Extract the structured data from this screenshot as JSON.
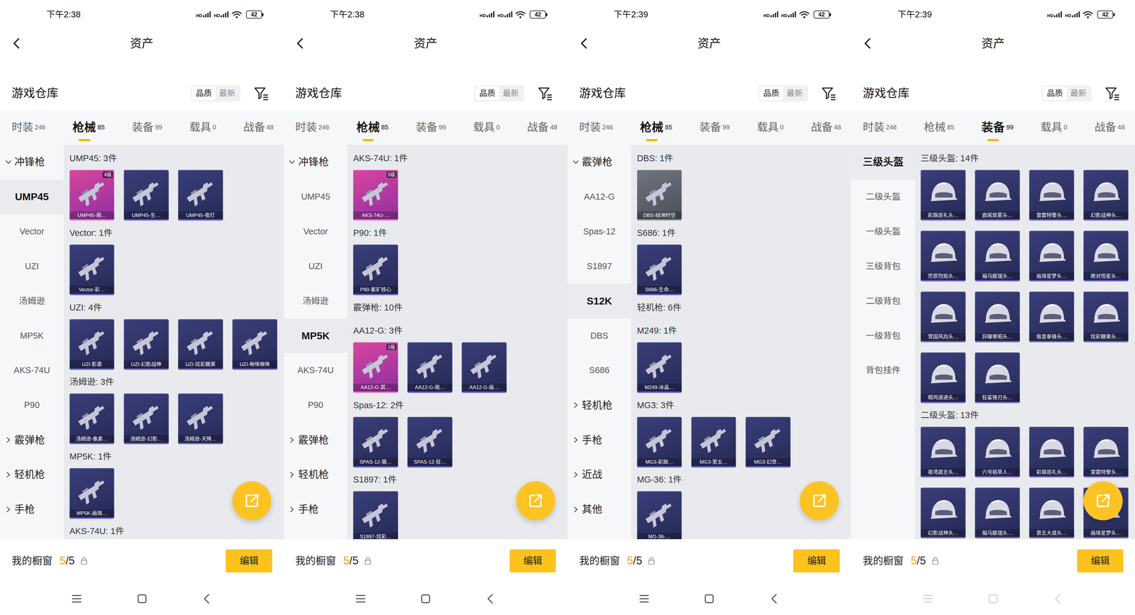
{
  "phones": [
    {
      "status": {
        "time": "下午2:38",
        "signal": [
          "HD",
          "HD"
        ],
        "battery": "42"
      },
      "title": "资产",
      "warehouse": {
        "title": "游戏仓库",
        "sort": [
          {
            "label": "品质",
            "selected": true
          },
          {
            "label": "最新",
            "selected": false
          }
        ]
      },
      "tabs": [
        {
          "label": "时装",
          "count": "246",
          "selected": false
        },
        {
          "label": "枪械",
          "count": "85",
          "selected": true
        },
        {
          "label": "装备",
          "count": "99",
          "selected": false
        },
        {
          "label": "载具",
          "count": "0",
          "selected": false
        },
        {
          "label": "战备",
          "count": "48",
          "selected": false
        }
      ],
      "sidebar": [
        {
          "label": "冲锋枪",
          "kind": "category",
          "expanded": true,
          "selected": false
        },
        {
          "label": "UMP45",
          "kind": "leaf",
          "selected": true
        },
        {
          "label": "Vector",
          "kind": "leaf",
          "selected": false
        },
        {
          "label": "UZI",
          "kind": "leaf",
          "selected": false
        },
        {
          "label": "汤姆逊",
          "kind": "leaf",
          "selected": false
        },
        {
          "label": "MP5K",
          "kind": "leaf",
          "selected": false
        },
        {
          "label": "AKS-74U",
          "kind": "leaf",
          "selected": false
        },
        {
          "label": "P90",
          "kind": "leaf",
          "selected": false
        },
        {
          "label": "霰弹枪",
          "kind": "category",
          "expanded": false,
          "selected": false
        },
        {
          "label": "轻机枪",
          "kind": "category",
          "expanded": false,
          "selected": false
        },
        {
          "label": "手枪",
          "kind": "category",
          "expanded": false,
          "selected": false
        }
      ],
      "sections": [
        {
          "title": "UMP45: 3件",
          "items": [
            {
              "label": "UMP45-萌…",
              "kind": "legendary",
              "badge": "4级"
            },
            {
              "label": "UMP45-生…",
              "kind": "epic"
            },
            {
              "label": "UMP45-夜灯",
              "kind": "epic"
            }
          ]
        },
        {
          "title": "Vector: 1件",
          "items": [
            {
              "label": "Vector-彩…",
              "kind": "epic"
            }
          ]
        },
        {
          "title": "UZI: 4件",
          "items": [
            {
              "label": "UZI-影袭",
              "kind": "epic"
            },
            {
              "label": "UZI-幻影战神",
              "kind": "epic"
            },
            {
              "label": "UZI-炫彩糖果",
              "kind": "epic"
            },
            {
              "label": "UZI-啾咪啾咪",
              "kind": "epic"
            }
          ]
        },
        {
          "title": "汤姆逊: 3件",
          "items": [
            {
              "label": "汤姆逊-像素…",
              "kind": "epic"
            },
            {
              "label": "汤姆逊-幻影…",
              "kind": "epic"
            },
            {
              "label": "汤姆逊-天降…",
              "kind": "epic"
            }
          ]
        },
        {
          "title": "MP5K: 1件",
          "items": [
            {
              "label": "MP5K-画境…",
              "kind": "epic"
            }
          ]
        },
        {
          "title": "AKS-74U: 1件",
          "items": []
        }
      ],
      "showcase": {
        "label": "我的橱窗",
        "used": "5",
        "total": "/5"
      },
      "edit_button": "编辑",
      "nav_faded": false
    },
    {
      "status": {
        "time": "下午2:38",
        "signal": [
          "HD",
          "HD"
        ],
        "battery": "42"
      },
      "title": "资产",
      "warehouse": {
        "title": "游戏仓库",
        "sort": [
          {
            "label": "品质",
            "selected": true
          },
          {
            "label": "最新",
            "selected": false
          }
        ]
      },
      "tabs": [
        {
          "label": "时装",
          "count": "246",
          "selected": false
        },
        {
          "label": "枪械",
          "count": "85",
          "selected": true
        },
        {
          "label": "装备",
          "count": "99",
          "selected": false
        },
        {
          "label": "载具",
          "count": "0",
          "selected": false
        },
        {
          "label": "战备",
          "count": "48",
          "selected": false
        }
      ],
      "sidebar": [
        {
          "label": "冲锋枪",
          "kind": "category",
          "expanded": true,
          "selected": false
        },
        {
          "label": "UMP45",
          "kind": "leaf",
          "selected": false
        },
        {
          "label": "Vector",
          "kind": "leaf",
          "selected": false
        },
        {
          "label": "UZI",
          "kind": "leaf",
          "selected": false
        },
        {
          "label": "汤姆逊",
          "kind": "leaf",
          "selected": false
        },
        {
          "label": "MP5K",
          "kind": "leaf",
          "selected": true
        },
        {
          "label": "AKS-74U",
          "kind": "leaf",
          "selected": false
        },
        {
          "label": "P90",
          "kind": "leaf",
          "selected": false
        },
        {
          "label": "霰弹枪",
          "kind": "category",
          "expanded": false,
          "selected": false
        },
        {
          "label": "轻机枪",
          "kind": "category",
          "expanded": false,
          "selected": false
        },
        {
          "label": "手枪",
          "kind": "category",
          "expanded": false,
          "selected": false
        }
      ],
      "sections": [
        {
          "title": "AKS-74U: 1件",
          "items": [
            {
              "label": "AKS-74U-…",
              "kind": "legendary",
              "badge": "5级"
            }
          ]
        },
        {
          "title": "P90: 1件",
          "items": [
            {
              "label": "P90-紫矿核心",
              "kind": "epic"
            }
          ]
        },
        {
          "title": "霰弹枪: 10件",
          "items": []
        },
        {
          "title": "AA12-G: 3件",
          "items": [
            {
              "label": "AA12-G-其…",
              "kind": "legendary",
              "badge": "1级"
            },
            {
              "label": "AA12-G-雨…",
              "kind": "epic"
            },
            {
              "label": "AA12-G-画…",
              "kind": "epic"
            }
          ]
        },
        {
          "title": "Spas-12: 2件",
          "items": [
            {
              "label": "SPAS-12-猫…",
              "kind": "epic"
            },
            {
              "label": "SPAS-12-狂…",
              "kind": "epic"
            }
          ]
        },
        {
          "title": "S1897: 1件",
          "items": [
            {
              "label": "S1897-炫彩…",
              "kind": "epic"
            }
          ]
        }
      ],
      "showcase": {
        "label": "我的橱窗",
        "used": "5",
        "total": "/5"
      },
      "edit_button": "编辑",
      "nav_faded": false
    },
    {
      "status": {
        "time": "下午2:39",
        "signal": [
          "HD",
          "HD"
        ],
        "battery": "42"
      },
      "title": "资产",
      "warehouse": {
        "title": "游戏仓库",
        "sort": [
          {
            "label": "品质",
            "selected": true
          },
          {
            "label": "最新",
            "selected": false
          }
        ]
      },
      "tabs": [
        {
          "label": "时装",
          "count": "246",
          "selected": false
        },
        {
          "label": "枪械",
          "count": "85",
          "selected": true
        },
        {
          "label": "装备",
          "count": "99",
          "selected": false
        },
        {
          "label": "载具",
          "count": "0",
          "selected": false
        },
        {
          "label": "战备",
          "count": "48",
          "selected": false
        }
      ],
      "sidebar": [
        {
          "label": "霰弹枪",
          "kind": "category",
          "expanded": true,
          "selected": false
        },
        {
          "label": "AA12-G",
          "kind": "leaf",
          "selected": false
        },
        {
          "label": "Spas-12",
          "kind": "leaf",
          "selected": false
        },
        {
          "label": "S1897",
          "kind": "leaf",
          "selected": false
        },
        {
          "label": "S12K",
          "kind": "leaf",
          "selected": true
        },
        {
          "label": "DBS",
          "kind": "leaf",
          "selected": false
        },
        {
          "label": "S686",
          "kind": "leaf",
          "selected": false
        },
        {
          "label": "轻机枪",
          "kind": "category",
          "expanded": false,
          "selected": false
        },
        {
          "label": "手枪",
          "kind": "category",
          "expanded": false,
          "selected": false
        },
        {
          "label": "近战",
          "kind": "category",
          "expanded": false,
          "selected": false
        },
        {
          "label": "其他",
          "kind": "category",
          "expanded": false,
          "selected": false
        }
      ],
      "sections": [
        {
          "title": "DBS: 1件",
          "items": [
            {
              "label": "DBS-绿洲时空",
              "kind": "grey"
            }
          ]
        },
        {
          "title": "S686: 1件",
          "items": [
            {
              "label": "S686-生命…",
              "kind": "epic"
            }
          ]
        },
        {
          "title": "轻机枪: 6件",
          "items": []
        },
        {
          "title": "M249: 1件",
          "items": [
            {
              "label": "M249-冰晶…",
              "kind": "epic"
            }
          ]
        },
        {
          "title": "MG3: 3件",
          "items": [
            {
              "label": "MG3-彩旗…",
              "kind": "epic"
            },
            {
              "label": "MG3-第五…",
              "kind": "epic"
            },
            {
              "label": "MG3-幻世…",
              "kind": "epic"
            }
          ]
        },
        {
          "title": "MG-36: 1件",
          "items": [
            {
              "label": "MG-36-…",
              "kind": "epic"
            }
          ]
        }
      ],
      "showcase": {
        "label": "我的橱窗",
        "used": "5",
        "total": "/5"
      },
      "edit_button": "编辑",
      "nav_faded": false
    },
    {
      "status": {
        "time": "下午2:39",
        "signal": [
          "HD",
          "HD"
        ],
        "battery": "42"
      },
      "title": "资产",
      "warehouse": {
        "title": "游戏仓库",
        "sort": [
          {
            "label": "品质",
            "selected": true
          },
          {
            "label": "最新",
            "selected": false
          }
        ]
      },
      "tabs": [
        {
          "label": "时装",
          "count": "246",
          "selected": false
        },
        {
          "label": "枪械",
          "count": "85",
          "selected": false
        },
        {
          "label": "装备",
          "count": "99",
          "selected": true
        },
        {
          "label": "载具",
          "count": "0",
          "selected": false
        },
        {
          "label": "战备",
          "count": "48",
          "selected": false
        }
      ],
      "sidebar": [
        {
          "label": "三级头盔",
          "kind": "leaf",
          "selected": true
        },
        {
          "label": "二级头盔",
          "kind": "leaf",
          "selected": false
        },
        {
          "label": "一级头盔",
          "kind": "leaf",
          "selected": false
        },
        {
          "label": "三级背包",
          "kind": "leaf",
          "selected": false
        },
        {
          "label": "二级背包",
          "kind": "leaf",
          "selected": false
        },
        {
          "label": "一级背包",
          "kind": "leaf",
          "selected": false
        },
        {
          "label": "背包挂件",
          "kind": "leaf",
          "selected": false
        }
      ],
      "sections": [
        {
          "title": "三级头盔: 14件",
          "items": [
            {
              "label": "彩旗巡礼头…",
              "kind": "epic"
            },
            {
              "label": "鹿尾斑雾头…",
              "kind": "epic"
            },
            {
              "label": "雷霆特警头…",
              "kind": "epic"
            },
            {
              "label": "幻影战神头…",
              "kind": "epic"
            },
            {
              "label": "荒原烈焰头…",
              "kind": "epic"
            },
            {
              "label": "福马献瑞头…",
              "kind": "epic"
            },
            {
              "label": "画境星梦头…",
              "kind": "epic"
            },
            {
              "label": "绝对恒星头…",
              "kind": "epic"
            },
            {
              "label": "雪国风尚头…",
              "kind": "epic"
            },
            {
              "label": "异瞳寒昭头…",
              "kind": "epic"
            },
            {
              "label": "极意拳锋头…",
              "kind": "epic"
            },
            {
              "label": "炫彩糖果头…",
              "kind": "epic"
            },
            {
              "label": "萌鸡速递头…",
              "kind": "epic"
            },
            {
              "label": "狂鲨锋刃头…",
              "kind": "epic"
            }
          ]
        },
        {
          "title": "二级头盔: 13件",
          "items": [
            {
              "label": "夜鸢蔬言头…",
              "kind": "epic"
            },
            {
              "label": "六号稻草人…",
              "kind": "epic"
            },
            {
              "label": "彩旗巡礼头…",
              "kind": "epic"
            },
            {
              "label": "雷霆特警头…",
              "kind": "epic"
            },
            {
              "label": "幻影战神头…",
              "kind": "epic"
            },
            {
              "label": "福马献瑞头…",
              "kind": "epic"
            },
            {
              "label": "第五大道头…",
              "kind": "epic"
            },
            {
              "label": "画境星梦头…",
              "kind": "epic"
            }
          ]
        }
      ],
      "showcase": {
        "label": "我的橱窗",
        "used": "5",
        "total": "/5"
      },
      "edit_button": "编辑",
      "nav_faded": true
    }
  ]
}
